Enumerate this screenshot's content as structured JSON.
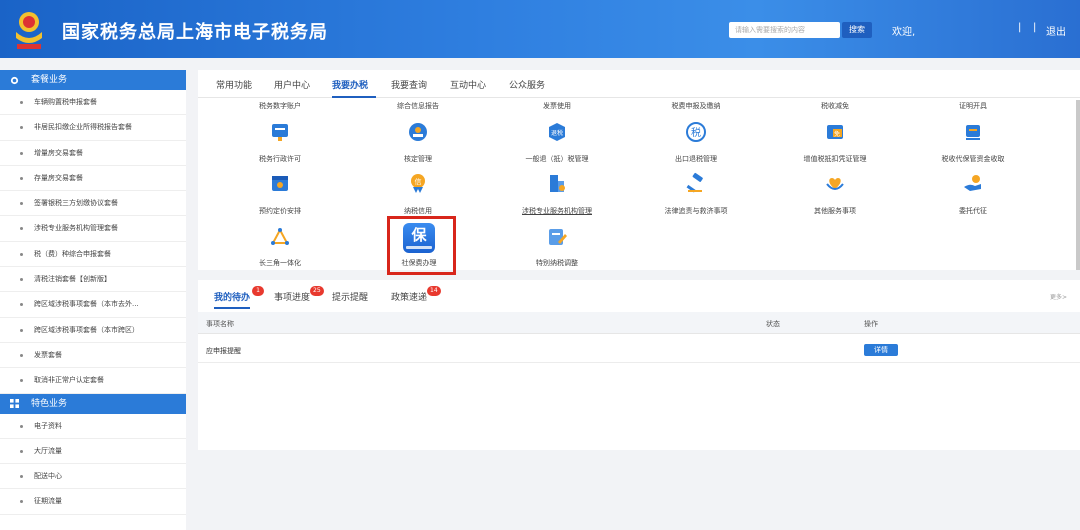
{
  "header": {
    "title": "国家税务总局上海市电子税务局",
    "search_placeholder": "请输入需要搜索的内容",
    "search_button": "搜索",
    "welcome": "欢迎,",
    "separator": "|",
    "logout": "退出"
  },
  "sidebar": {
    "section1": "套餐业务",
    "items1": [
      "车辆购置税申报套餐",
      "非居民扣缴企业所得税报告套餐",
      "增量房交易套餐",
      "存量房交易套餐",
      "签署银税三方划缴协议套餐",
      "涉税专业服务机构管理套餐",
      "税（费）种综合申报套餐",
      "清税注销套餐【创新版】",
      "跨区域涉税事项套餐（本市去外...",
      "跨区域涉税事项套餐（本市跨区）",
      "发票套餐",
      "取消非正常户认定套餐"
    ],
    "section2": "特色业务",
    "items2": [
      "电子资料",
      "大厅流量",
      "配送中心",
      "征期流量"
    ]
  },
  "tabs": [
    "常用功能",
    "用户中心",
    "我要办税",
    "我要查询",
    "互动中心",
    "公众服务"
  ],
  "grid": {
    "row0_labels": [
      "税务数字账户",
      "综合信息报告",
      "发票使用",
      "税费申报及缴纳",
      "税收减免",
      "证明开具"
    ],
    "row1_labels": [
      "税务行政许可",
      "核定管理",
      "一般退（抵）税管理",
      "出口退税管理",
      "增值税抵扣凭证管理",
      "税收代保管资金收取"
    ],
    "row2_labels": [
      "预约定价安排",
      "纳税信用",
      "涉税专业服务机构管理",
      "法律追责与救济事项",
      "其他服务事项",
      "委托代征"
    ],
    "row3_labels": [
      "长三角一体化",
      "社保费办理",
      "特别纳税调整"
    ],
    "icon_chars": {
      "tax": "税",
      "tui": "退税",
      "xin": "信",
      "bao": "保",
      "mian": "免"
    }
  },
  "todo": {
    "tabs": [
      {
        "label": "我的待办",
        "badge": "1"
      },
      {
        "label": "事项进度",
        "badge": "25"
      },
      {
        "label": "提示提醒",
        "badge": ""
      },
      {
        "label": "政策速递",
        "badge": "14"
      }
    ],
    "more": "更多>",
    "columns": [
      "事项名称",
      "状态",
      "操作"
    ],
    "rows": [
      {
        "name": "应申报提醒",
        "status": "",
        "action": "详情"
      }
    ]
  },
  "colors": {
    "primary": "#2b7bd8",
    "header": "#1a63c7",
    "highlight": "#d8261b",
    "badge": "#e8392e"
  }
}
